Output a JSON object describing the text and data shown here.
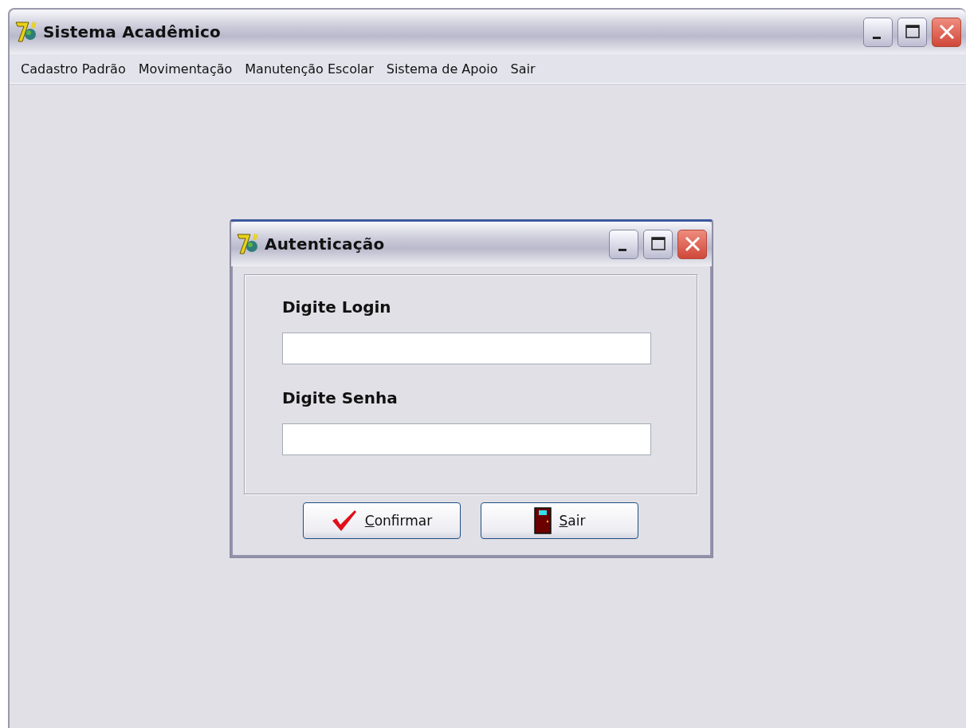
{
  "window": {
    "title": "Sistema Acadêmico"
  },
  "menu": [
    {
      "label": "Cadastro Padrão"
    },
    {
      "label": "Movimentação"
    },
    {
      "label": "Manutenção Escolar"
    },
    {
      "label": "Sistema de Apoio"
    },
    {
      "label": "Sair"
    }
  ],
  "dialog": {
    "title": "Autenticação",
    "fields": [
      {
        "label": "Digite Login"
      },
      {
        "label": "Digite Senha"
      }
    ],
    "buttons": [
      {
        "kind": "confirm",
        "label": "Confirmar"
      },
      {
        "kind": "exit",
        "label": "Sair"
      }
    ]
  }
}
